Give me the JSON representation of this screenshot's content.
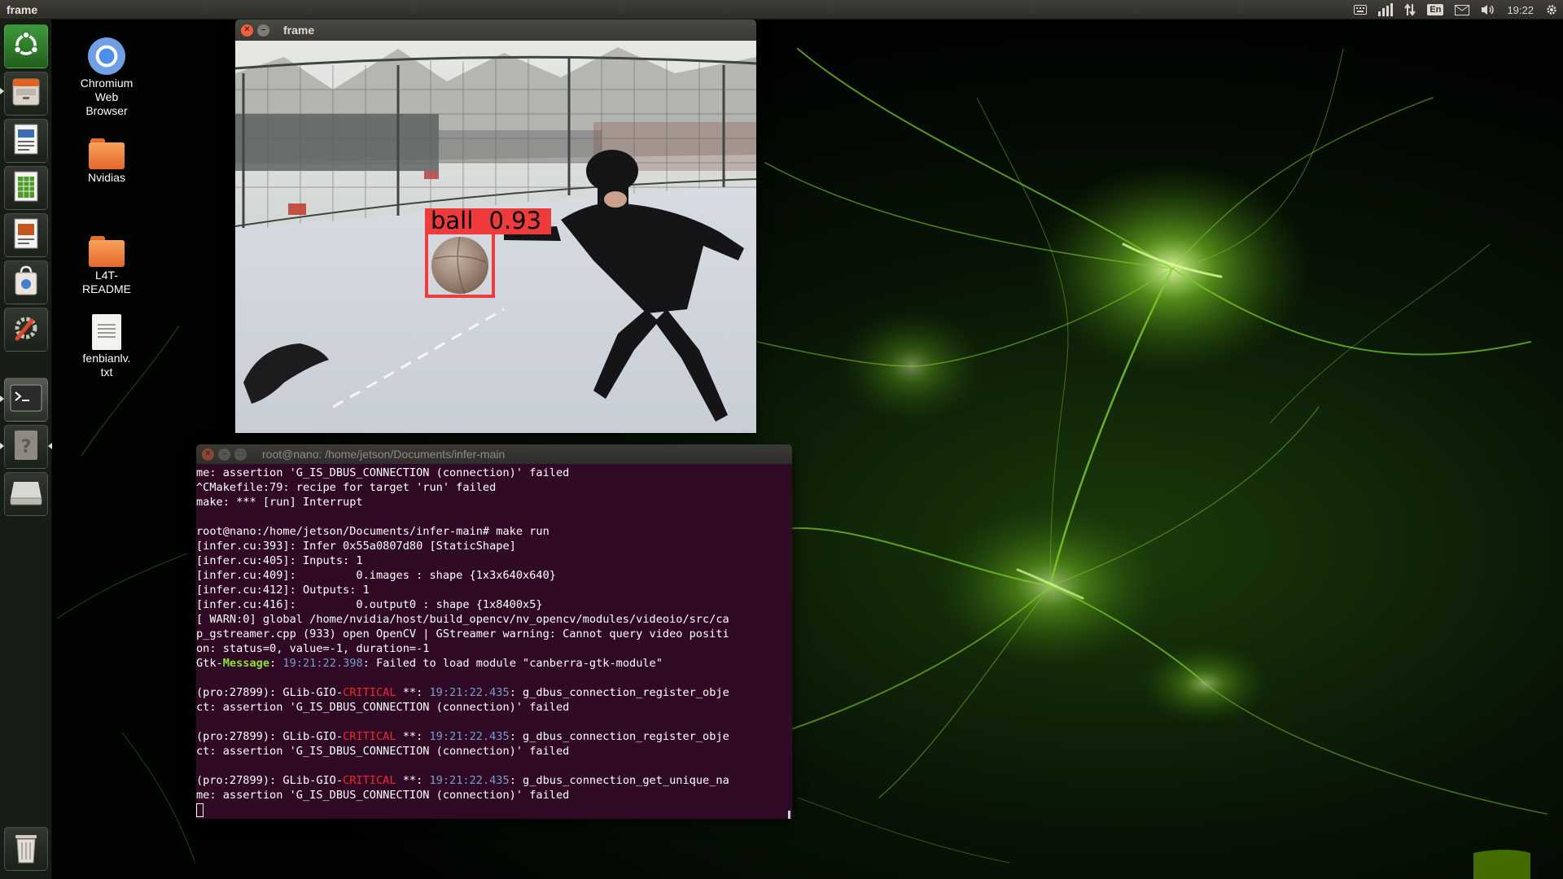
{
  "top_panel": {
    "app_title": "frame",
    "clock": "19:22",
    "language": "En",
    "icons": [
      "keyboard-icon",
      "network-icon",
      "transfer-icon",
      "mail-icon",
      "volume-icon",
      "gear-icon"
    ]
  },
  "launcher": {
    "items": [
      {
        "name": "launcher-dash",
        "icon": "ubuntu-icon"
      },
      {
        "name": "launcher-files",
        "icon": "file-cabinet-icon"
      },
      {
        "name": "launcher-writer",
        "icon": "document-icon"
      },
      {
        "name": "launcher-calc",
        "icon": "spreadsheet-icon"
      },
      {
        "name": "launcher-impress",
        "icon": "presentation-icon"
      },
      {
        "name": "launcher-software",
        "icon": "shopping-bag-icon"
      },
      {
        "name": "launcher-settings",
        "icon": "wrench-icon"
      },
      {
        "name": "launcher-terminal",
        "icon": "terminal-icon"
      },
      {
        "name": "launcher-help",
        "icon": "question-icon"
      },
      {
        "name": "launcher-drive",
        "icon": "drive-icon"
      },
      {
        "name": "launcher-trash",
        "icon": "trash-icon"
      }
    ]
  },
  "desktop": {
    "chromium": "Chromium Web Browser",
    "chromium_l1": "Chromium",
    "chromium_l2": "Web",
    "chromium_l3": "Browser",
    "nvidias": "Nvidias",
    "l4t_l1": "L4T-",
    "l4t_l2": "README",
    "fenbian_l1": "fenbianlv.",
    "fenbian_l2": "txt"
  },
  "frame_window": {
    "title": "frame",
    "detection": {
      "label": "ball",
      "score": "0.93",
      "box_color": "#ee3b3b"
    }
  },
  "terminal": {
    "title": "root@nano: /home/jetson/Documents/infer-main",
    "lines": [
      [
        {
          "t": "me: assertion 'G_IS_DBUS_CONNECTION (connection)' failed"
        }
      ],
      [
        {
          "t": "^CMakefile:79: recipe for target 'run' failed"
        }
      ],
      [
        {
          "t": "make: *** [run] Interrupt"
        }
      ],
      [
        {
          "t": ""
        }
      ],
      [
        {
          "t": "root@nano:/home/jetson/Documents/infer-main# make run"
        }
      ],
      [
        {
          "t": "[infer.cu:393]: Infer 0x55a0807d80 [StaticShape]"
        }
      ],
      [
        {
          "t": "[infer.cu:405]: Inputs: 1"
        }
      ],
      [
        {
          "t": "[infer.cu:409]:         0.images : shape {1x3x640x640}"
        }
      ],
      [
        {
          "t": "[infer.cu:412]: Outputs: 1"
        }
      ],
      [
        {
          "t": "[infer.cu:416]:         0.output0 : shape {1x8400x5}"
        }
      ],
      [
        {
          "t": "[ WARN:0] global /home/nvidia/host/build_opencv/nv_opencv/modules/videoio/src/ca"
        }
      ],
      [
        {
          "t": "p_gstreamer.cpp (933) open OpenCV | GStreamer warning: Cannot query video positi"
        }
      ],
      [
        {
          "t": "on: status=0, value=-1, duration=-1"
        }
      ],
      [
        {
          "t": "Gtk-"
        },
        {
          "t": "Message",
          "c": "green"
        },
        {
          "t": ": "
        },
        {
          "t": "19:21:22.398",
          "c": "blue"
        },
        {
          "t": ": Failed to load module \"canberra-gtk-module\""
        }
      ],
      [
        {
          "t": ""
        }
      ],
      [
        {
          "t": "(pro:27899): GLib-GIO-"
        },
        {
          "t": "CRITICAL",
          "c": "red"
        },
        {
          "t": " **: "
        },
        {
          "t": "19:21:22.435",
          "c": "blue"
        },
        {
          "t": ": g_dbus_connection_register_obje"
        }
      ],
      [
        {
          "t": "ct: assertion 'G_IS_DBUS_CONNECTION (connection)' failed"
        }
      ],
      [
        {
          "t": ""
        }
      ],
      [
        {
          "t": "(pro:27899): GLib-GIO-"
        },
        {
          "t": "CRITICAL",
          "c": "red"
        },
        {
          "t": " **: "
        },
        {
          "t": "19:21:22.435",
          "c": "blue"
        },
        {
          "t": ": g_dbus_connection_register_obje"
        }
      ],
      [
        {
          "t": "ct: assertion 'G_IS_DBUS_CONNECTION (connection)' failed"
        }
      ],
      [
        {
          "t": ""
        }
      ],
      [
        {
          "t": "(pro:27899): GLib-GIO-"
        },
        {
          "t": "CRITICAL",
          "c": "red"
        },
        {
          "t": " **: "
        },
        {
          "t": "19:21:22.435",
          "c": "blue"
        },
        {
          "t": ": g_dbus_connection_get_unique_na"
        }
      ],
      [
        {
          "t": "me: assertion 'G_IS_DBUS_CONNECTION (connection)' failed"
        }
      ]
    ]
  },
  "colors": {
    "terminal_bg": "#300a24",
    "wallpaper_accent": "#76b900",
    "close_button": "#f0613a"
  }
}
